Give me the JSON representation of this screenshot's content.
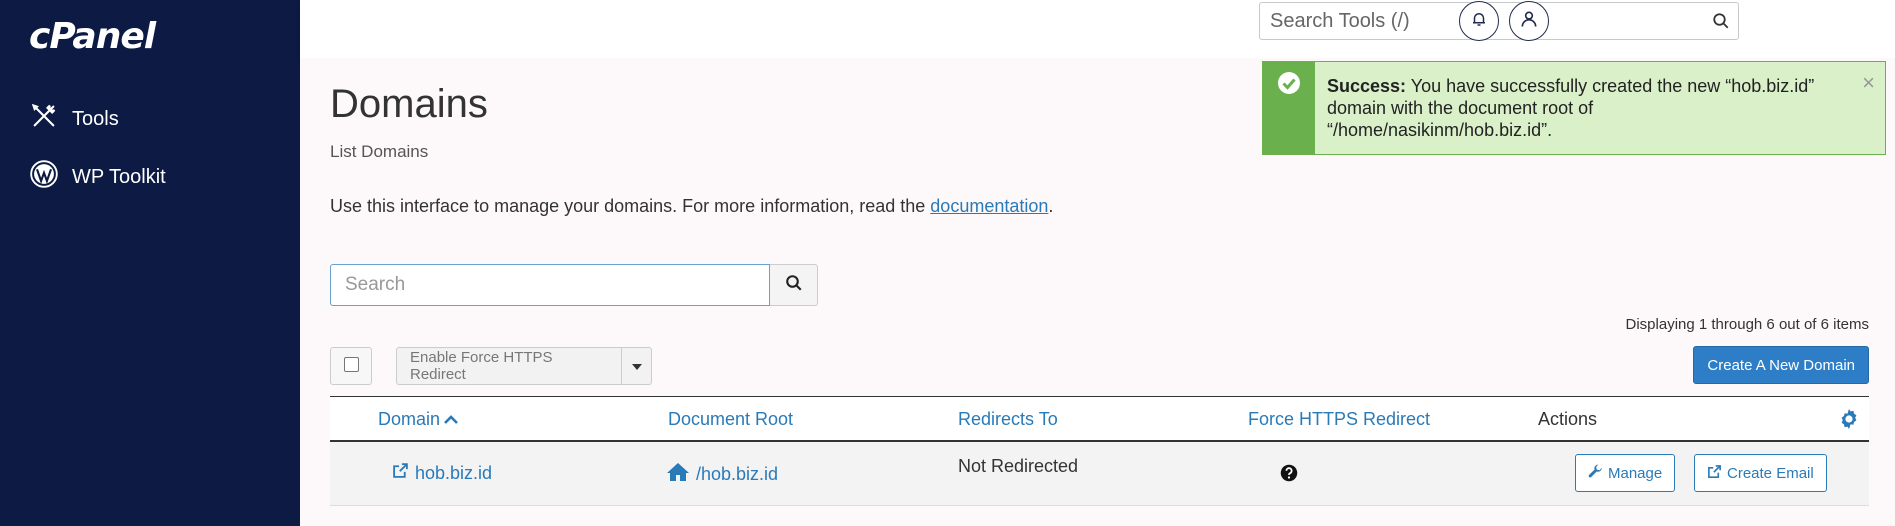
{
  "app": {
    "logo_text": "cPanel"
  },
  "sidebar": {
    "items": [
      {
        "label": "Tools",
        "icon": "tools-icon"
      },
      {
        "label": "WP Toolkit",
        "icon": "wordpress-icon"
      }
    ]
  },
  "topbar": {
    "search_placeholder": "Search Tools (/)"
  },
  "page": {
    "title": "Domains",
    "subtitle": "List Domains",
    "intro_text": "Use this interface to manage your domains. For more information, read the ",
    "intro_link": "documentation",
    "intro_end": "."
  },
  "search": {
    "placeholder": "Search"
  },
  "pagination": {
    "displaying": "Displaying 1 through 6 out of 6 items"
  },
  "toolbar": {
    "https_label": "Enable Force HTTPS Redirect",
    "create_label": "Create A New Domain"
  },
  "table": {
    "headers": {
      "domain": "Domain",
      "docroot": "Document Root",
      "redirects": "Redirects To",
      "force_https": "Force HTTPS Redirect",
      "actions": "Actions"
    },
    "rows": [
      {
        "domain": "hob.biz.id",
        "docroot": "/hob.biz.id",
        "redirects": "Not Redirected",
        "manage_label": "Manage",
        "email_label": "Create Email"
      }
    ]
  },
  "alert": {
    "strong": "Success:",
    "message": " You have successfully created the new “hob.biz.id” domain with the document root of “/home/nasikinm/hob.biz.id”.",
    "close": "×"
  },
  "colors": {
    "sidebar": "#0c1a44",
    "accent": "#2d7ec7",
    "link": "#2a7ab8",
    "success": "#6ab04c",
    "success_bg": "#d9f0c9"
  }
}
